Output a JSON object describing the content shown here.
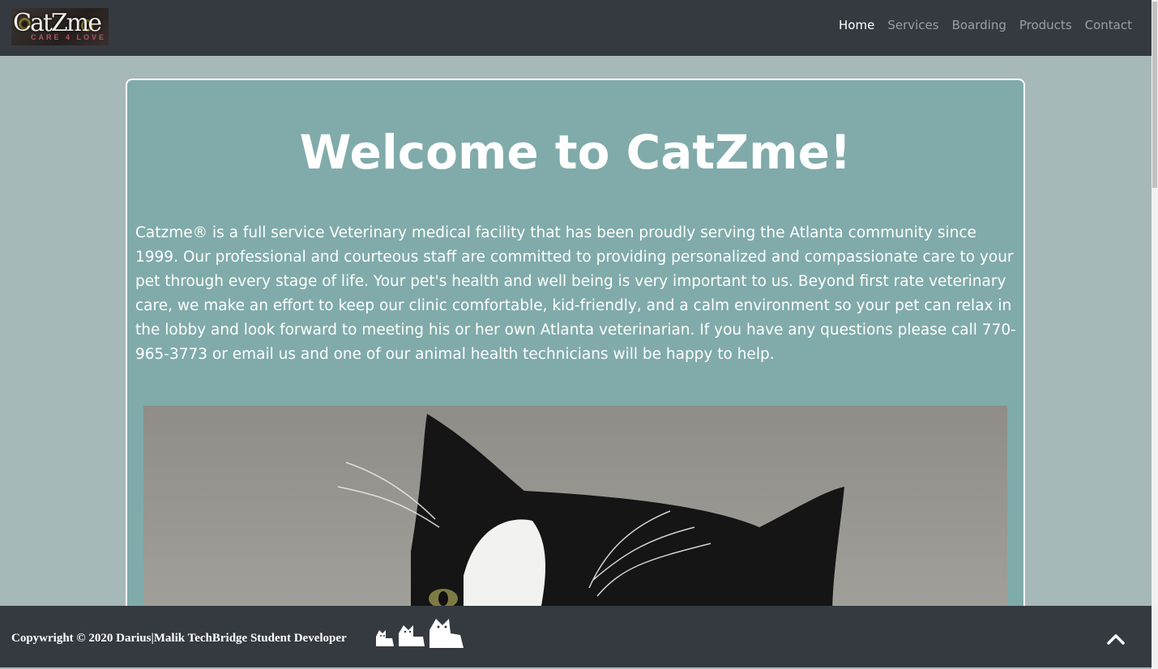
{
  "header": {
    "logo": {
      "word": "CatZme",
      "tagline": "CARE 4 LOVE"
    },
    "nav": [
      {
        "label": "Home",
        "active": true
      },
      {
        "label": "Services",
        "active": false
      },
      {
        "label": "Boarding",
        "active": false
      },
      {
        "label": "Products",
        "active": false
      },
      {
        "label": "Contact",
        "active": false
      }
    ]
  },
  "main": {
    "title": "Welcome to CatZme!",
    "intro": "Catzme® is a full service Veterinary medical facility that has been proudly serving the Atlanta community since 1999. Our professional and courteous staff are committed to providing personalized and compassionate care to your pet through every stage of life. Your pet's health and well being is very important to us. Beyond first rate veterinary care, we make an effort to keep our clinic comfortable, kid-friendly, and a calm environment so your pet can relax in the lobby and look forward to meeting his or her own Atlanta veterinarian. If you have any questions please call 770-965-3773 or email us and one of our animal health technicians will be happy to help.",
    "photo_icon": "cat-photo"
  },
  "footer": {
    "copyright": "Copywright © 2020 Darius|Malik TechBridge Student Developer",
    "icons": [
      "cat-icon",
      "cat-icon",
      "cat-icon"
    ],
    "back_to_top_icon": "chevron-up-icon"
  },
  "colors": {
    "navbar": "#343a40",
    "page_bg": "#a6b8b7",
    "card_bg": "#80abaa",
    "card_border": "#ffffff",
    "nav_active": "#ffffff"
  }
}
